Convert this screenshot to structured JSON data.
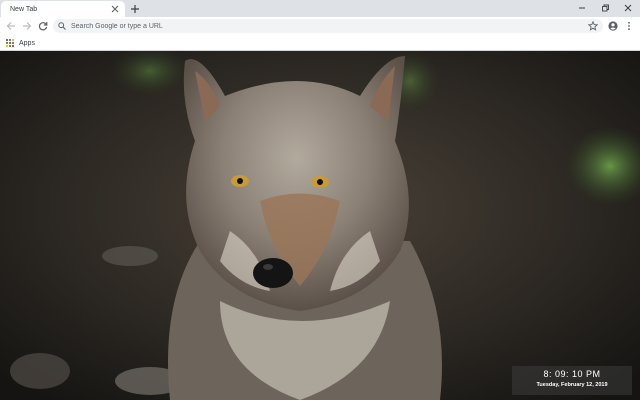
{
  "tabs": [
    {
      "title": "New Tab",
      "active": true
    }
  ],
  "toolbar": {
    "omnibox_placeholder": "Search Google or type a URL"
  },
  "bookmarks": {
    "apps_label": "Apps"
  },
  "clock": {
    "time": "8: 09: 10 PM",
    "date": "Tuesday, February 12, 2019"
  },
  "icons": {
    "tab_close": "close-icon",
    "new_tab": "plus-icon",
    "back": "arrow-left-icon",
    "forward": "arrow-right-icon",
    "reload": "reload-icon",
    "search": "search-icon",
    "bookmark": "star-icon",
    "profile": "account-icon",
    "menu": "kebab-menu-icon",
    "apps": "grid-icon"
  },
  "colors": {
    "tabstrip": "#dee1e6",
    "toolbar": "#ffffff",
    "omnibox": "#f1f3f4",
    "icon": "#5f6368",
    "clock_bg": "#3c3c3c"
  }
}
